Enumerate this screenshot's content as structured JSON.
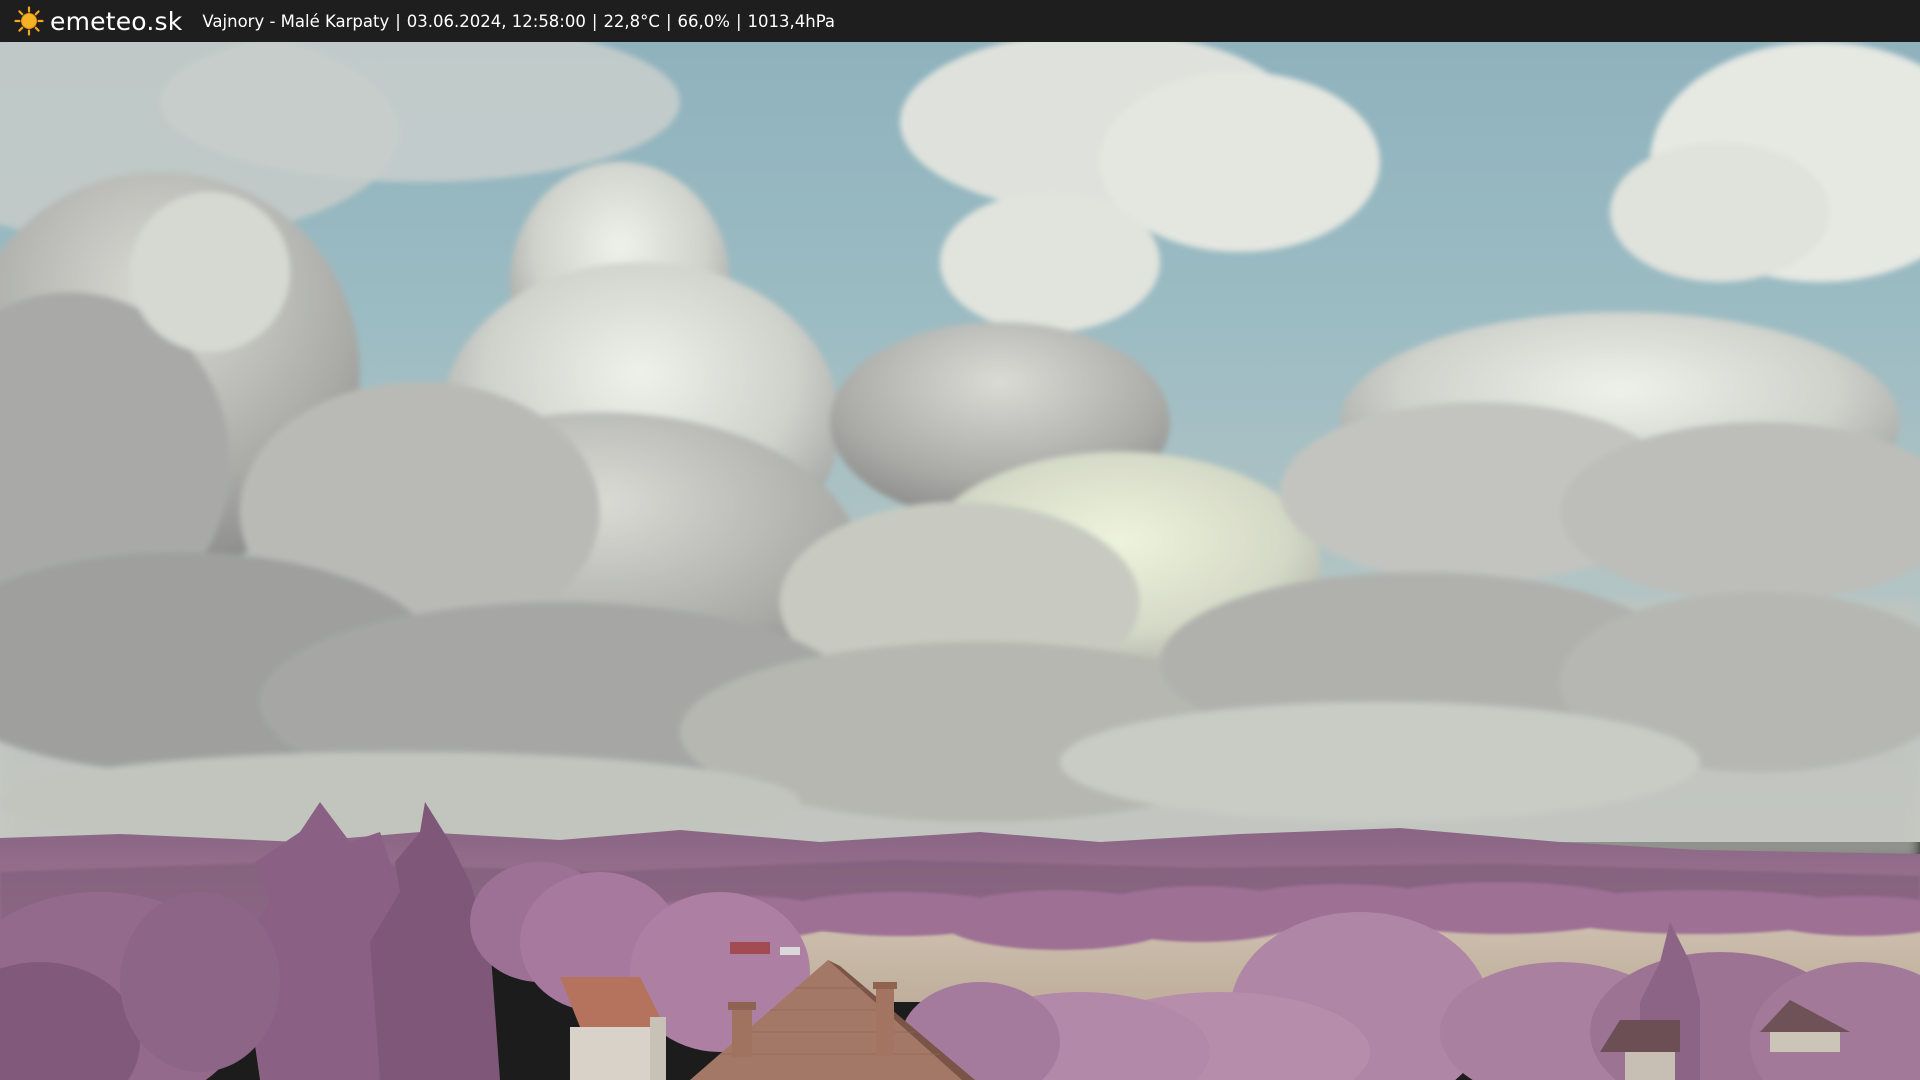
{
  "header": {
    "brand": "emeteo.sk",
    "location": "Vajnory - Malé Karpaty",
    "datetime": "03.06.2024, 12:58:00",
    "temperature": "22,8°C",
    "humidity": "66,0%",
    "pressure": "1013,4hPa",
    "separator": "|"
  },
  "icons": {
    "logo": "sun-icon"
  },
  "colors": {
    "bar_background": "#1e1e1e",
    "bar_text": "#ffffff",
    "sun": "#f5a623",
    "sky_blue": "#7aa3b3",
    "cloud": "#d9d9d2",
    "vegetation": "#9c6f92",
    "field": "#c9b9a6",
    "roof": "#b07660"
  }
}
